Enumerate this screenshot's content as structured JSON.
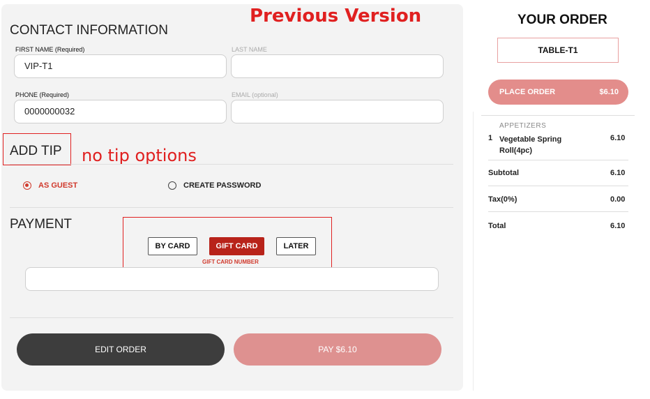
{
  "annotations": {
    "title": "Previous Version",
    "tip_note": "no tip options"
  },
  "contact": {
    "heading": "CONTACT INFORMATION",
    "first_name": {
      "label": "FIRST NAME (Required)",
      "value": "VIP-T1"
    },
    "last_name": {
      "label": "LAST NAME",
      "value": ""
    },
    "phone": {
      "label": "PHONE (Required)",
      "value": "0000000032"
    },
    "email": {
      "label": "EMAIL (optional)",
      "value": ""
    }
  },
  "tip": {
    "heading": "ADD TIP"
  },
  "account": {
    "options": [
      {
        "label": "AS GUEST",
        "selected": true
      },
      {
        "label": "CREATE PASSWORD",
        "selected": false
      }
    ]
  },
  "payment": {
    "heading": "PAYMENT",
    "methods": [
      {
        "label": "BY CARD",
        "active": false
      },
      {
        "label": "GIFT CARD",
        "active": true
      },
      {
        "label": "LATER",
        "active": false
      }
    ],
    "gift_card_label": "GIFT CARD NUMBER",
    "gift_card_value": ""
  },
  "actions": {
    "edit_order": "EDIT ORDER",
    "pay": "PAY $6.10"
  },
  "order": {
    "title": "YOUR ORDER",
    "table": "TABLE-T1",
    "place_order": {
      "label": "PLACE ORDER",
      "amount": "$6.10"
    },
    "category": "APPETIZERS",
    "items": [
      {
        "qty": "1",
        "name": "Vegetable Spring Roll(4pc)",
        "price": "6.10"
      }
    ],
    "subtotal": {
      "label": "Subtotal",
      "value": "6.10"
    },
    "tax": {
      "label": "Tax(0%)",
      "value": "0.00"
    },
    "total": {
      "label": "Total",
      "value": "6.10"
    }
  },
  "colors": {
    "accent_red": "#b8231a",
    "annotation_red": "#e02020",
    "pink_button": "#de9190",
    "dark_button": "#3d3d3d"
  }
}
